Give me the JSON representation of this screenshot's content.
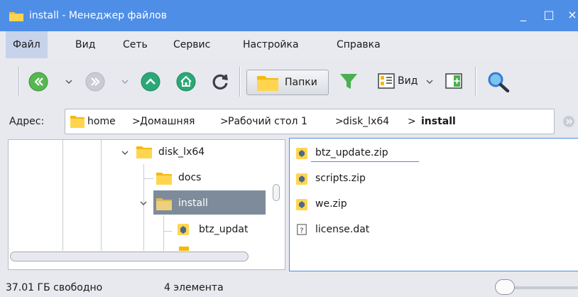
{
  "window": {
    "title": "install - Менеджер файлов",
    "controls": {
      "minimize": "_",
      "maximize": "□",
      "close": "×"
    }
  },
  "menu": [
    "Файл",
    "Вид",
    "Сеть",
    "Сервис",
    "Настройка",
    "Справка"
  ],
  "toolbar": {
    "folders_label": "Папки",
    "view_label": "Вид",
    "icons": [
      "back-icon",
      "forward-icon",
      "up-icon",
      "home-icon",
      "refresh-icon",
      "folder-icon",
      "filter-icon",
      "view-icon",
      "split-view-icon",
      "search-icon"
    ]
  },
  "address": {
    "label": "Адрес:",
    "crumbs": [
      "home",
      "Домашняя",
      "Рабочий стол 1",
      "disk_lx64",
      "install"
    ]
  },
  "tree": {
    "items": [
      {
        "label": "disk_lx64",
        "type": "folder",
        "state": "expanded"
      },
      {
        "label": "docs",
        "type": "folder"
      },
      {
        "label": "install",
        "type": "folder",
        "state": "expanded",
        "selected": true
      },
      {
        "label": "btz_updat",
        "type": "zip"
      }
    ]
  },
  "files": {
    "items": [
      {
        "name": "btz_update.zip",
        "type": "zip",
        "focused": true
      },
      {
        "name": "scripts.zip",
        "type": "zip"
      },
      {
        "name": "we.zip",
        "type": "zip"
      },
      {
        "name": "license.dat",
        "type": "unknown"
      }
    ]
  },
  "status": {
    "free": "37.01 ГБ свободно",
    "count": "4 элемента"
  },
  "colors": {
    "titlebar": "#4e8ee6",
    "selection": "#7e8b9a",
    "accent_green": "#4caf50",
    "accent_teal": "#2aa876",
    "search_blue": "#2f7fd0"
  }
}
